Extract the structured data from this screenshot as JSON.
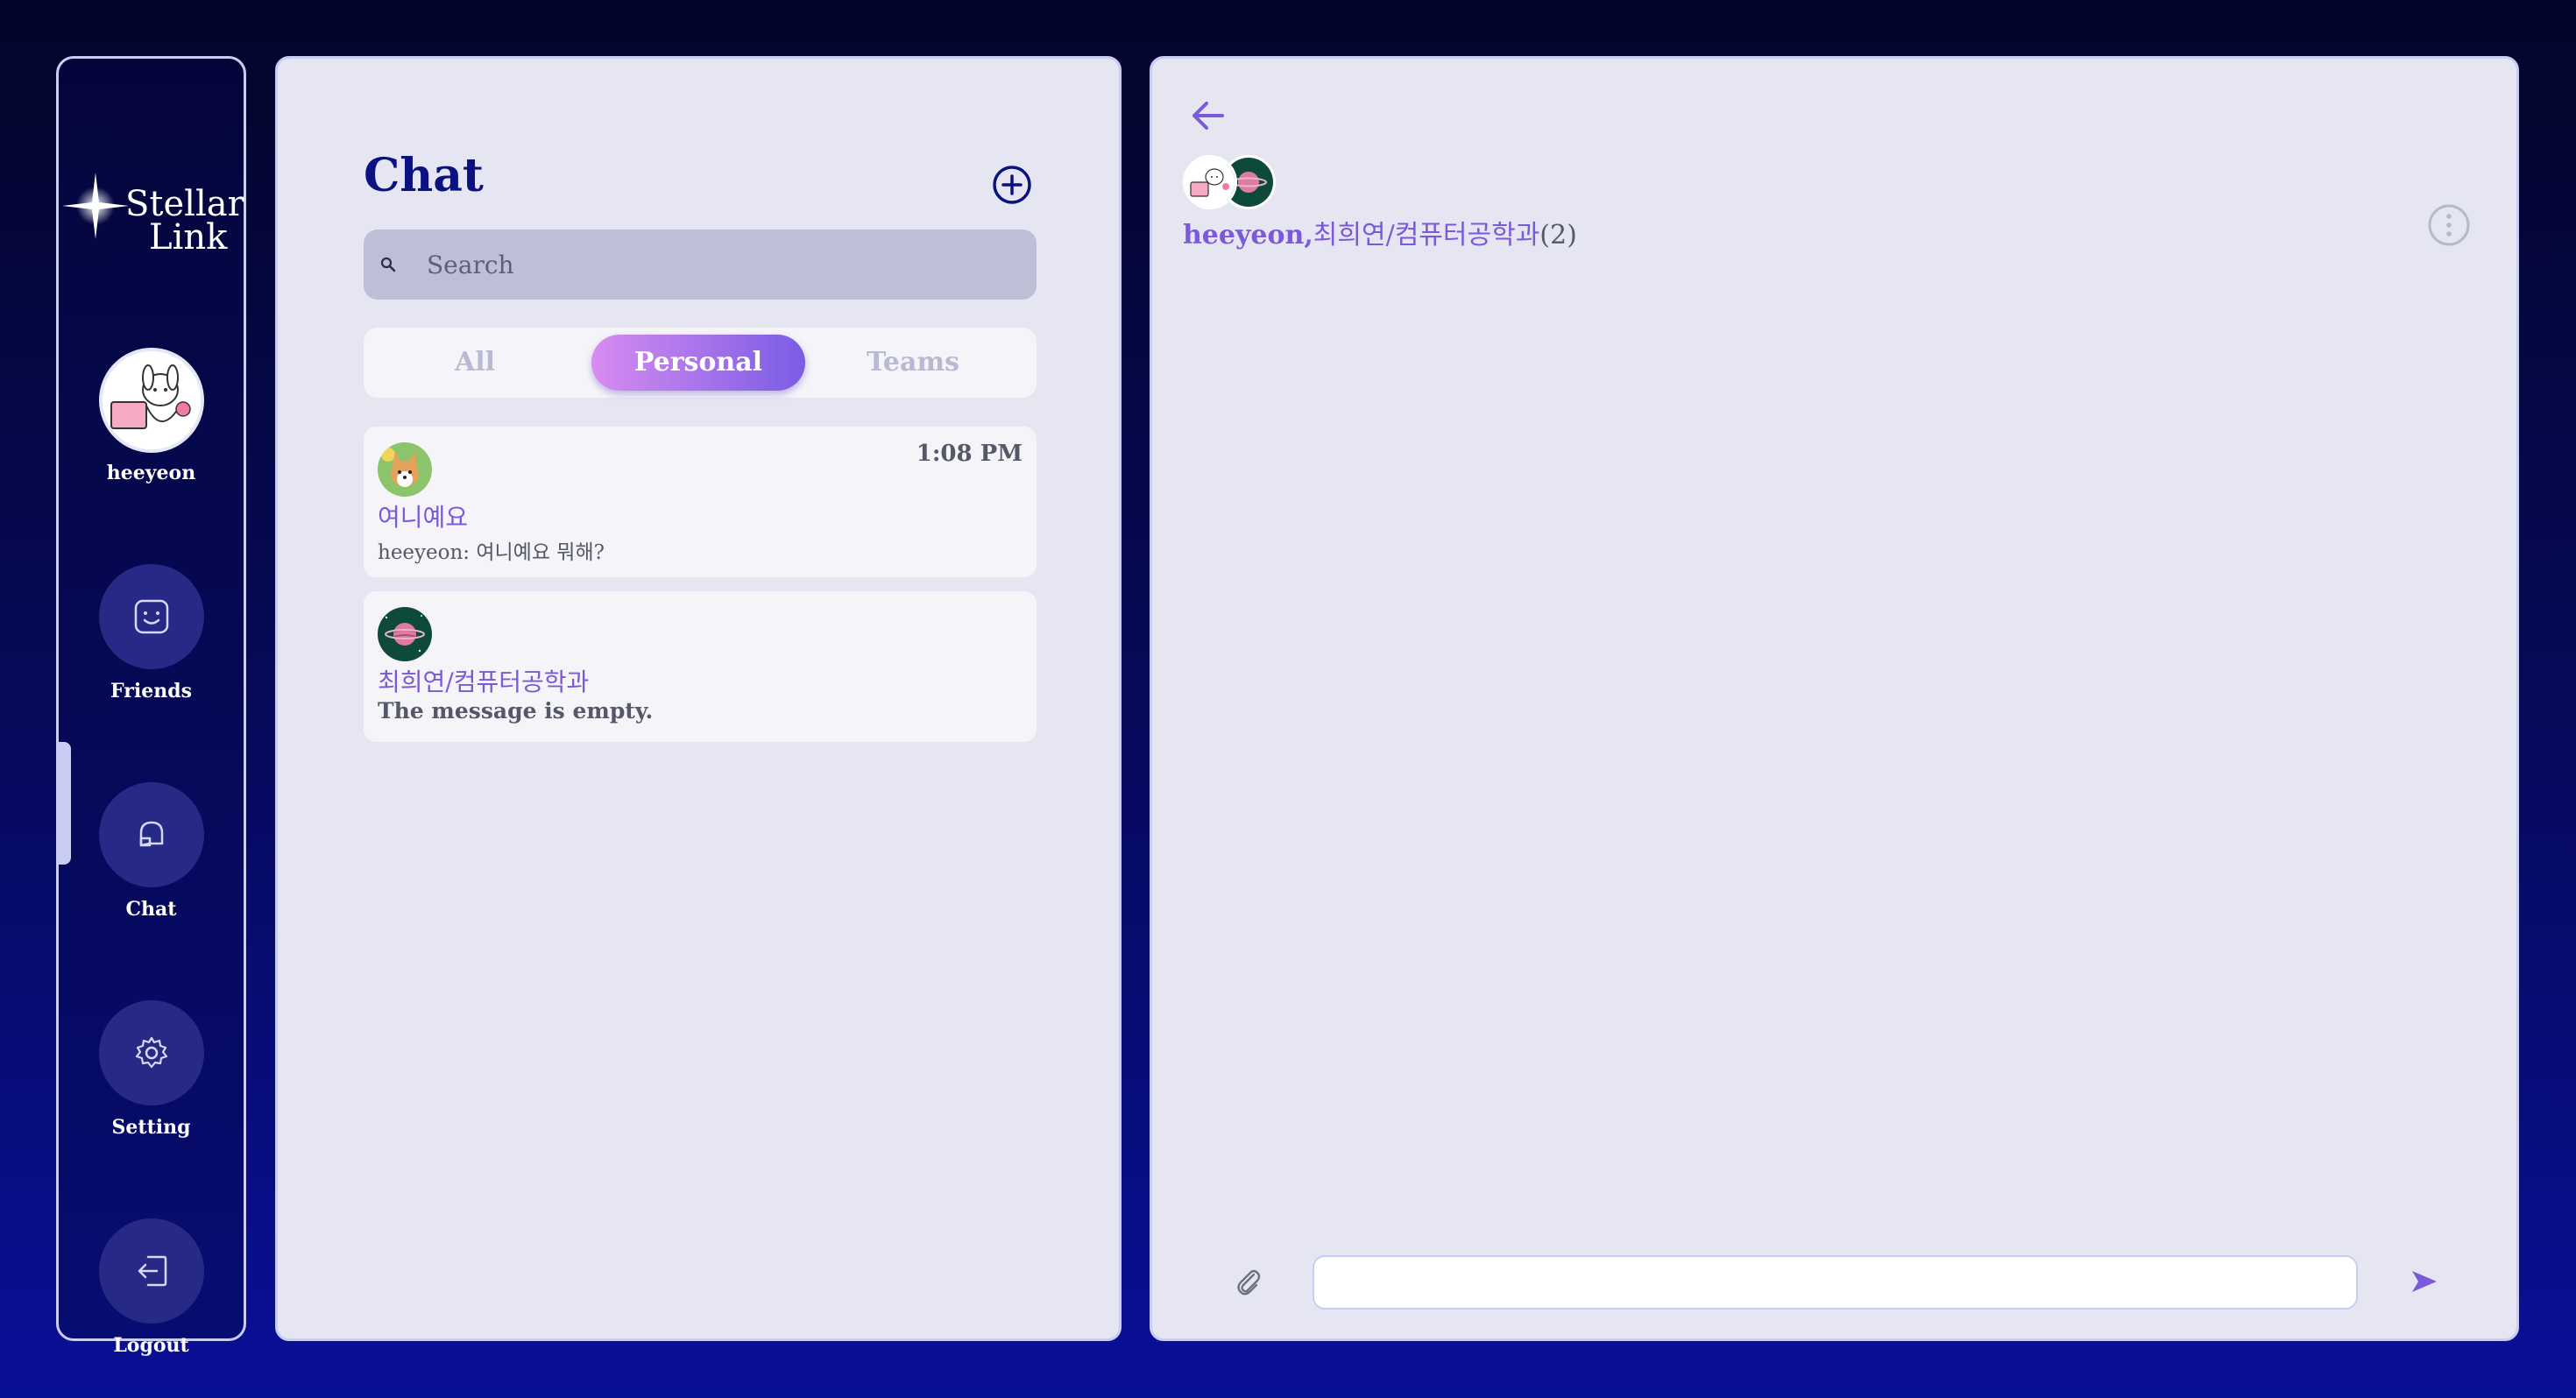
{
  "app": {
    "logo_line1": "Stellar",
    "logo_line2": "Link"
  },
  "user": {
    "name": "heeyeon"
  },
  "nav": {
    "items": [
      {
        "label": "Friends",
        "icon": "smiley-icon"
      },
      {
        "label": "Chat",
        "icon": "chat-bubble-icon"
      },
      {
        "label": "Setting",
        "icon": "gear-icon"
      },
      {
        "label": "Logout",
        "icon": "logout-icon"
      }
    ],
    "active": "Chat"
  },
  "chat_list": {
    "title": "Chat",
    "search_placeholder": "Search",
    "tabs": [
      {
        "label": "All",
        "active": false
      },
      {
        "label": "Personal",
        "active": true
      },
      {
        "label": "Teams",
        "active": false
      }
    ],
    "rooms": [
      {
        "name": "여니예요",
        "time": "1:08 PM",
        "preview": "heeyeon: 여니예요 뭐해?"
      },
      {
        "name": "최희연/컴퓨터공학과",
        "time": "",
        "preview": "The message is empty."
      }
    ]
  },
  "conversation": {
    "title_me": "heeyeon,",
    "title_other": "최희연/컴퓨터공학과",
    "member_count": "(2)",
    "input_value": ""
  },
  "colors": {
    "accent": "#7a5ad8",
    "navy": "#0c1182",
    "panel": "#e6e6f2",
    "tab_gradient_start": "#d78cf0",
    "tab_gradient_end": "#7a5ce6"
  }
}
